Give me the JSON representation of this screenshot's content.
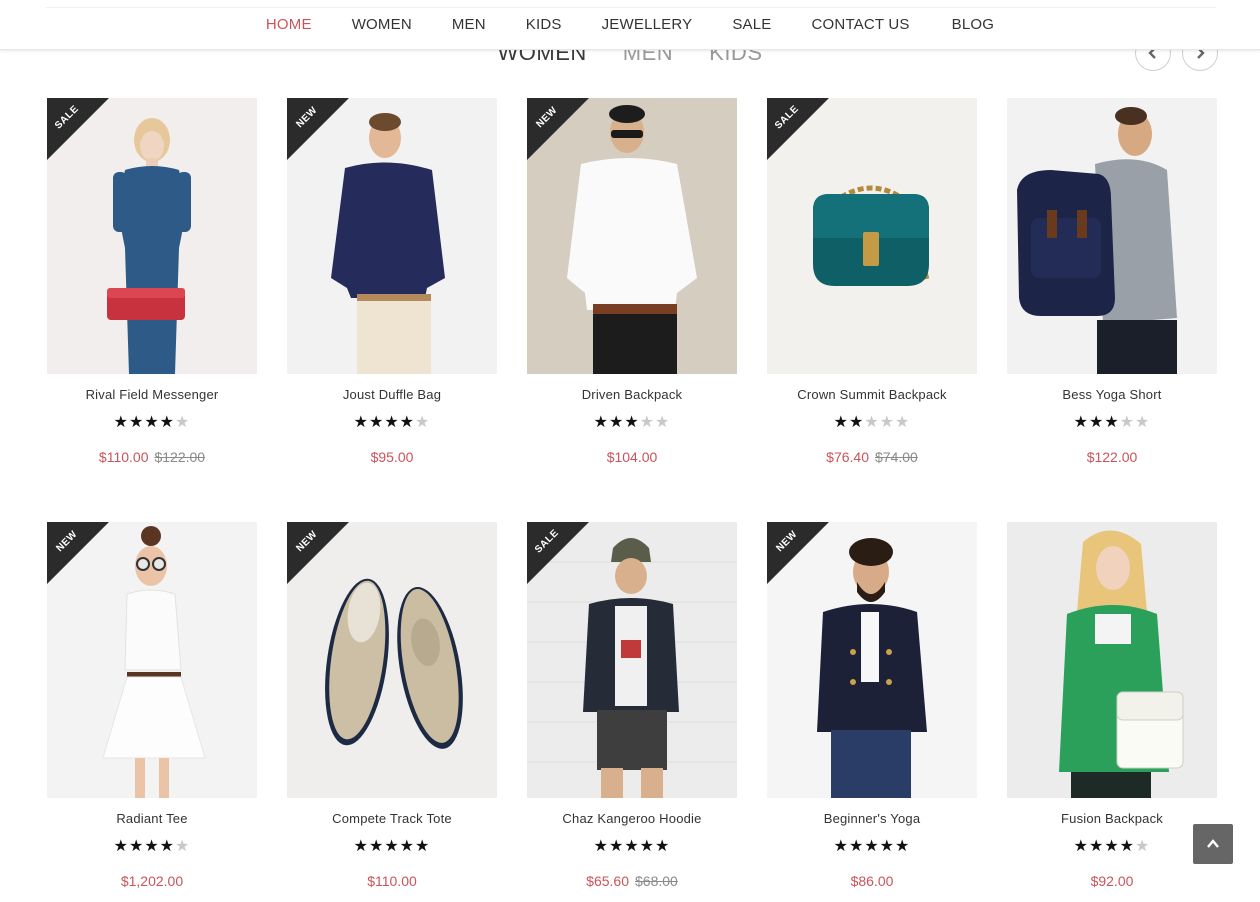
{
  "nav": {
    "items": [
      "HOME",
      "WOMEN",
      "MEN",
      "KIDS",
      "JEWELLERY",
      "SALE",
      "CONTACT US",
      "BLOG"
    ],
    "active_index": 0,
    "accent_color": "#c9545a"
  },
  "category_tabs": {
    "items": [
      "WOMEN",
      "MEN",
      "KIDS"
    ],
    "active_index": 0
  },
  "carousel": {
    "prev_icon": "chevron-left-icon",
    "next_icon": "chevron-right-icon"
  },
  "products": [
    {
      "badge": "SALE",
      "name": "Rival Field Messenger",
      "rating": 4,
      "price": "$110.00",
      "old_price": "$122.00",
      "image": "woman-blue-dress-red-clutch"
    },
    {
      "badge": "NEW",
      "name": "Joust Duffle Bag",
      "rating": 4,
      "price": "$95.00",
      "old_price": "",
      "image": "man-navy-polo"
    },
    {
      "badge": "NEW",
      "name": "Driven Backpack",
      "rating": 3,
      "price": "$104.00",
      "old_price": "",
      "image": "man-white-shirt-sunglasses"
    },
    {
      "badge": "SALE",
      "name": "Crown Summit Backpack",
      "rating": 2,
      "price": "$76.40",
      "old_price": "$74.00",
      "image": "teal-handbag"
    },
    {
      "badge": "",
      "name": "Bess Yoga Short",
      "rating": 3,
      "price": "$122.00",
      "old_price": "",
      "image": "man-navy-backpack"
    },
    {
      "badge": "NEW",
      "name": "Radiant Tee",
      "rating": 4,
      "price": "$1,202.00",
      "old_price": "",
      "image": "woman-white-dress"
    },
    {
      "badge": "NEW",
      "name": "Compete Track Tote",
      "rating": 5,
      "price": "$110.00",
      "old_price": "",
      "image": "beige-boat-shoes"
    },
    {
      "badge": "SALE",
      "name": "Chaz Kangeroo Hoodie",
      "rating": 5,
      "price": "$65.60",
      "old_price": "$68.00",
      "image": "man-beanie-jacket"
    },
    {
      "badge": "NEW",
      "name": "Beginner's Yoga",
      "rating": 5,
      "price": "$86.00",
      "old_price": "",
      "image": "man-pipe-navy-coat"
    },
    {
      "badge": "",
      "name": "Fusion Backpack",
      "rating": 4,
      "price": "$92.00",
      "old_price": "",
      "image": "woman-green-coat-white-bag"
    }
  ],
  "scroll_top": {
    "icon": "chevron-up-icon"
  }
}
